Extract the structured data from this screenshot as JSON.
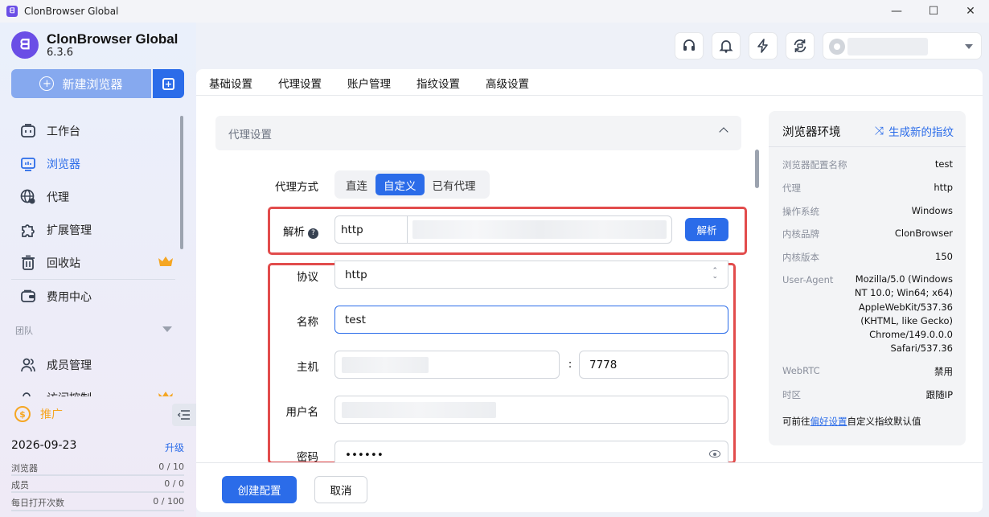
{
  "window": {
    "title": "ClonBrowser Global",
    "controls": [
      "—",
      "☐",
      "✕"
    ]
  },
  "brand": {
    "name": "ClonBrowser Global",
    "version": "6.3.6"
  },
  "sidebar": {
    "new_browser_label": "新建浏览器",
    "items": [
      {
        "label": "工作台",
        "icon": "workbench-icon"
      },
      {
        "label": "浏览器",
        "icon": "browser-icon",
        "active": true
      },
      {
        "label": "代理",
        "icon": "globe-icon"
      },
      {
        "label": "扩展管理",
        "icon": "puzzle-icon"
      },
      {
        "label": "回收站",
        "icon": "trash-icon",
        "crown": true
      },
      {
        "label": "费用中心",
        "icon": "wallet-icon"
      }
    ],
    "team_label": "团队",
    "team_items": [
      {
        "label": "成员管理",
        "icon": "members-icon"
      },
      {
        "label": "访问控制",
        "icon": "access-icon",
        "crown": true
      }
    ],
    "promo_label": "推广",
    "expiry_date": "2026-09-23",
    "upgrade_label": "升级",
    "stats": [
      {
        "label": "浏览器",
        "value": "0 / 10"
      },
      {
        "label": "成员",
        "value": "0 / 0"
      },
      {
        "label": "每日打开次数",
        "value": "0 / 100"
      }
    ]
  },
  "tabs": [
    "基础设置",
    "代理设置",
    "账户管理",
    "指纹设置",
    "高级设置"
  ],
  "proxy": {
    "section_title": "代理设置",
    "mode_label": "代理方式",
    "modes": [
      "直连",
      "自定义",
      "已有代理"
    ],
    "mode_selected": "自定义",
    "parse_label": "解析",
    "parse_protocol": "http",
    "parse_button": "解析",
    "protocol_label": "协议",
    "protocol_value": "http",
    "name_label": "名称",
    "name_value": "test",
    "host_label": "主机",
    "host_sep": ":",
    "port_value": "7778",
    "username_label": "用户名",
    "password_label": "密码",
    "password_value": "••••••"
  },
  "footer": {
    "create_label": "创建配置",
    "cancel_label": "取消"
  },
  "env": {
    "title": "浏览器环境",
    "generate_label": "生成新的指纹",
    "rows": [
      {
        "k": "浏览器配置名称",
        "v": "test"
      },
      {
        "k": "代理",
        "v": "http"
      },
      {
        "k": "操作系统",
        "v": "Windows"
      },
      {
        "k": "内核品牌",
        "v": "ClonBrowser"
      },
      {
        "k": "内核版本",
        "v": "150"
      }
    ],
    "ua_label": "User-Agent",
    "ua_value": "Mozilla/5.0 (Windows NT 10.0; Win64; x64) AppleWebKit/537.36 (KHTML, like Gecko) Chrome/149.0.0.0 Safari/537.36",
    "rows2": [
      {
        "k": "WebRTC",
        "v": "禁用"
      },
      {
        "k": "时区",
        "v": "跟随IP"
      }
    ],
    "note_prefix": "可前往",
    "note_link": "偏好设置",
    "note_suffix": "自定义指纹默认值"
  },
  "colors": {
    "accent": "#2b6ce9",
    "highlight": "#e24c4c",
    "crown": "#f5a623",
    "brand": "#6a4ee6"
  }
}
